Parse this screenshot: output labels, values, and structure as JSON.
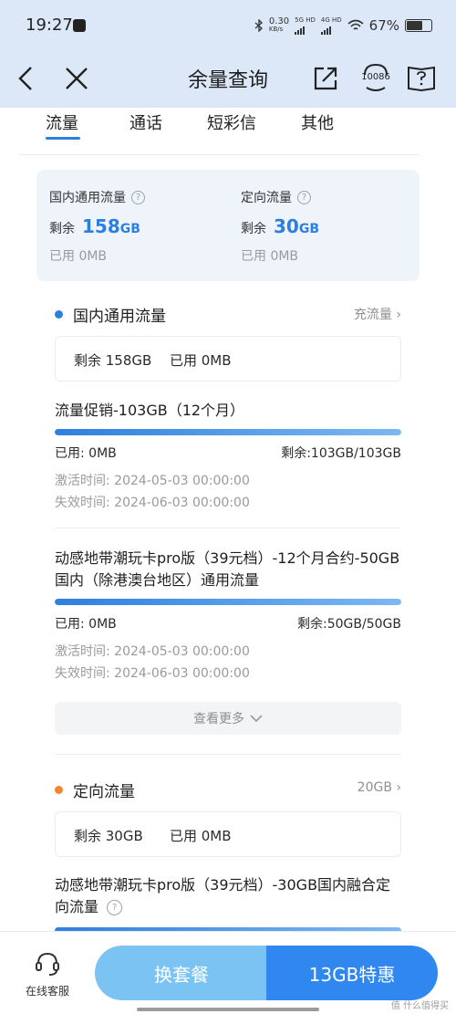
{
  "status": {
    "time": "19:27",
    "net_speed_top": "0.30",
    "net_speed_unit": "KB/s",
    "sim1": "5G HD",
    "sim2": "4G HD",
    "battery": "67%"
  },
  "nav": {
    "title": "余量查询",
    "service_number": "10086"
  },
  "tabs": [
    {
      "label": "流量",
      "active": true
    },
    {
      "label": "通话",
      "active": false
    },
    {
      "label": "短彩信",
      "active": false
    },
    {
      "label": "其他",
      "active": false
    }
  ],
  "summary": {
    "left": {
      "label": "国内通用流量",
      "remain_prefix": "剩余",
      "remain_value": "158",
      "remain_unit": "GB",
      "used": "已用 0MB"
    },
    "right": {
      "label": "定向流量",
      "remain_prefix": "剩余",
      "remain_value": "30",
      "remain_unit": "GB",
      "used": "已用 0MB"
    }
  },
  "domestic": {
    "title": "国内通用流量",
    "action": "充流量",
    "remain": "剩余 158GB",
    "used": "已用 0MB",
    "packages": [
      {
        "name": "流量促销-103GB（12个月）",
        "used": "已用: 0MB",
        "remain": "剩余:103GB/103GB",
        "remain_fraction": 1.0,
        "activated": "激活时间: 2024-05-03 00:00:00",
        "expires": "失效时间: 2024-06-03 00:00:00"
      },
      {
        "name": "动感地带潮玩卡pro版（39元档）-12个月合约-50GB国内（除港澳台地区）通用流量",
        "used": "已用: 0MB",
        "remain": "剩余:50GB/50GB",
        "remain_fraction": 1.0,
        "activated": "激活时间: 2024-05-03 00:00:00",
        "expires": "失效时间: 2024-06-03 00:00:00"
      }
    ],
    "more": "查看更多"
  },
  "directed": {
    "title": "定向流量",
    "action": "20GB",
    "remain": "剩余 30GB",
    "used": "已用 0MB",
    "package_name": "动感地带潮玩卡pro版（39元档）-30GB国内融合定向流量"
  },
  "bottom": {
    "service": "在线客服",
    "change_plan": "换套餐",
    "offer": "13GB特惠"
  },
  "watermark": "值 什么值得买",
  "colors": {
    "accent": "#2b7fe0",
    "dot_domestic": "#2b7fe0",
    "dot_directed": "#f0882b",
    "header_bg": "#dce8f7"
  }
}
